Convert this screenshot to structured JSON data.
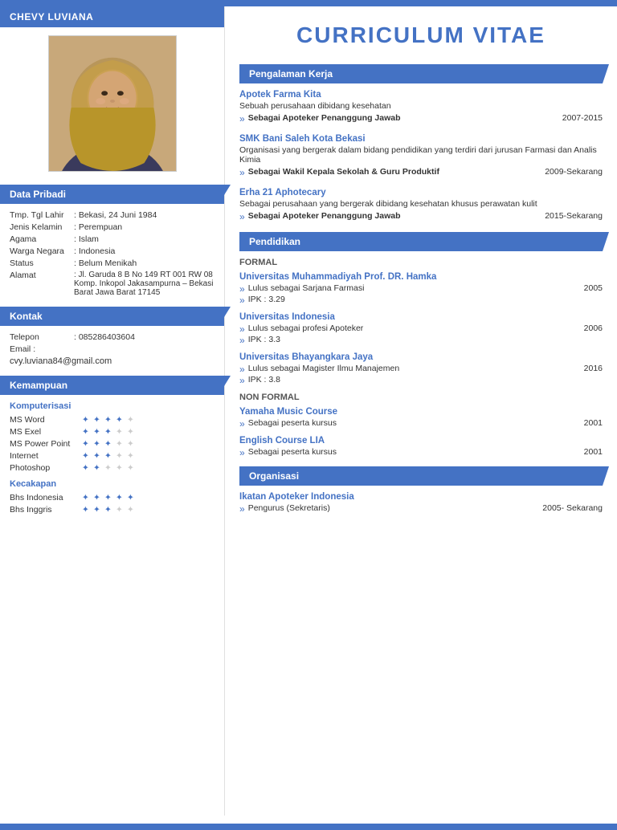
{
  "topbar": {},
  "sidebar": {
    "name": "CHEVY LUVIANA",
    "sections": {
      "data_pribadi": "Data Pribadi",
      "kontak": "Kontak",
      "kemampuan": "Kemampuan"
    },
    "personal": {
      "tmp_tgl_lahir_label": "Tmp. Tgl Lahir",
      "tmp_tgl_lahir_value": ": Bekasi, 24 Juni 1984",
      "jenis_kelamin_label": "Jenis Kelamin",
      "jenis_kelamin_value": ": Perempuan",
      "agama_label": "Agama",
      "agama_value": ": Islam",
      "warga_negara_label": "Warga Negara",
      "warga_negara_value": ": Indonesia",
      "status_label": "Status",
      "status_value": ": Belum Menikah",
      "alamat_label": "Alamat",
      "alamat_value": ": Jl. Garuda 8 B No 149 RT 001 RW 08 Komp. Inkopol Jakasampurna – Bekasi Barat Jawa Barat 17145"
    },
    "contact": {
      "telepon_label": "Telepon",
      "telepon_value": ": 085286403604",
      "email_label": "Email",
      "email_colon": ":",
      "email_value": "cvy.luviana84@gmail.com"
    },
    "komputerisasi_label": "Komputerisasi",
    "skills_computer": [
      {
        "name": "MS Word",
        "filled": 4,
        "total": 5
      },
      {
        "name": "MS Exel",
        "filled": 3,
        "total": 5
      },
      {
        "name": "MS Power Point",
        "filled": 3,
        "total": 5
      },
      {
        "name": "Internet",
        "filled": 3,
        "total": 5
      },
      {
        "name": "Photoshop",
        "filled": 2,
        "total": 5
      }
    ],
    "kecakapan_label": "Kecakapan",
    "skills_language": [
      {
        "name": "Bhs Indonesia",
        "filled": 5,
        "total": 5
      },
      {
        "name": "Bhs Inggris",
        "filled": 3,
        "total": 5
      }
    ]
  },
  "main": {
    "title": "CURRICULUM VITAE",
    "pengalaman_kerja": "Pengalaman Kerja",
    "pendidikan": "Pendidikan",
    "organisasi": "Organisasi",
    "work": [
      {
        "company": "Apotek Farma Kita",
        "desc": "Sebuah perusahaan dibidang kesehatan",
        "role": "Sebagai Apoteker Penanggung Jawab",
        "year": "2007-2015"
      },
      {
        "company": "SMK Bani Saleh Kota Bekasi",
        "desc": "Organisasi yang bergerak dalam bidang pendidikan yang terdiri dari jurusan Farmasi dan Analis Kimia",
        "role": "Sebagai Wakil Kepala Sekolah & Guru Produktif",
        "year": "2009-Sekarang"
      },
      {
        "company": "Erha  21 Aphotecary",
        "desc": "Sebagai perusahaan yang bergerak dibidang kesehatan khusus perawatan kulit",
        "role": "Sebagai Apoteker Penanggung Jawab",
        "year": "2015-Sekarang"
      }
    ],
    "formal_label": "FORMAL",
    "edu_formal": [
      {
        "university": "Universitas Muhammadiyah Prof. DR. Hamka",
        "degree": "Lulus sebagai Sarjana Farmasi",
        "year": "2005",
        "ipk": "IPK : 3.29"
      },
      {
        "university": "Universitas Indonesia",
        "degree": "Lulus sebagai profesi Apoteker",
        "year": "2006",
        "ipk": "IPK : 3.3"
      },
      {
        "university": "Universitas Bhayangkara Jaya",
        "degree": "Lulus sebagai Magister Ilmu Manajemen",
        "year": "2016",
        "ipk": "IPK : 3.8"
      }
    ],
    "non_formal_label": "NON FORMAL",
    "edu_nonformal": [
      {
        "course": "Yamaha Music Course",
        "desc": "Sebagai peserta kursus",
        "year": "2001"
      },
      {
        "course": "English Course LIA",
        "desc": "Sebagai peserta kursus",
        "year": "2001"
      }
    ],
    "org": [
      {
        "name": "Ikatan Apoteker Indonesia",
        "role": "Pengurus (Sekretaris)",
        "year": "2005- Sekarang"
      }
    ]
  }
}
